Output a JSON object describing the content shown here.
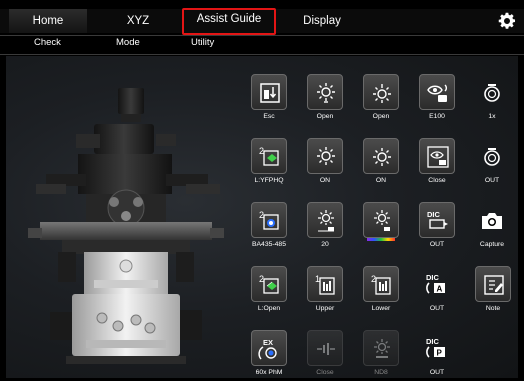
{
  "tabs": {
    "home": "Home",
    "xyz": "XYZ",
    "assist": "Assist Guide",
    "display": "Display"
  },
  "subtabs": {
    "check": "Check",
    "mode": "Mode",
    "utility": "Utility"
  },
  "highlight_color": "#e31515",
  "buttons": {
    "row1": [
      "Esc",
      "Open",
      "Open",
      "E100",
      "1x"
    ],
    "row2": [
      "L:YFPHQ",
      "ON",
      "ON",
      "Close",
      "OUT"
    ],
    "row3": [
      "BA435-485",
      "20",
      "",
      "OUT",
      "Capture"
    ],
    "row4": [
      "L:Open",
      "Upper",
      "Lower",
      "OUT",
      "Note"
    ],
    "row5": [
      "60x PhM",
      "Close",
      "ND8",
      "OUT"
    ]
  },
  "badges": {
    "filter_l": "2",
    "filter_ba": "2",
    "turret_upper": "1",
    "turret_lower": "2",
    "filter_open": "2",
    "dic": "DIC",
    "ex": "EX",
    "dic_a": "A",
    "dic_p": "P",
    "intensity_20": "20"
  }
}
